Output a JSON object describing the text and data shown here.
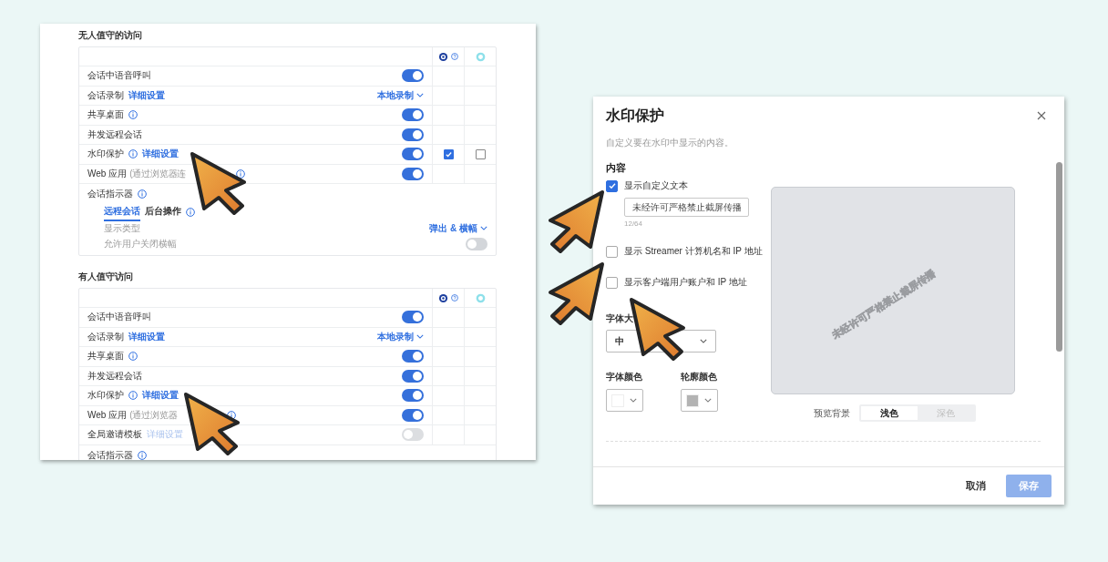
{
  "sections": [
    {
      "title": "无人值守的访问",
      "rows": [
        {
          "label": "会话中语音呼叫",
          "disabled": false,
          "control": {
            "kind": "toggle",
            "on": true
          }
        },
        {
          "label": "会话录制",
          "link": "详细设置",
          "disabled": false,
          "control": {
            "kind": "dropdown",
            "value": "本地录制"
          }
        },
        {
          "label": "共享桌面",
          "info": true,
          "disabled": false,
          "control": {
            "kind": "toggle",
            "on": true
          }
        },
        {
          "label": "并发远程会话",
          "disabled": false,
          "control": {
            "kind": "toggle",
            "on": true
          }
        },
        {
          "label": "水印保护",
          "info": true,
          "link": "详细设置",
          "disabled": false,
          "control": {
            "kind": "toggle",
            "on": true
          },
          "checks": [
            {
              "checked": true
            },
            {
              "checked": false
            }
          ]
        },
        {
          "label": "Web 应用",
          "note": "(通过浏览器连",
          "info": true,
          "disabled": false,
          "control": {
            "kind": "toggle",
            "on": true
          }
        }
      ],
      "indicator": {
        "label": "会话指示器",
        "info": true,
        "tabs": [
          {
            "label": "远程会话",
            "selected": true
          },
          {
            "label": "后台操作",
            "selected": false,
            "info": true
          }
        ],
        "settings": [
          {
            "label": "显示类型",
            "control": {
              "kind": "dropdown",
              "value": "弹出 & 横幅"
            }
          },
          {
            "label": "允许用户关闭横幅",
            "control": {
              "kind": "toggle",
              "on": false
            }
          }
        ]
      }
    },
    {
      "title": "有人值守访问",
      "rows": [
        {
          "label": "会话中语音呼叫",
          "disabled": false,
          "control": {
            "kind": "toggle",
            "on": true
          }
        },
        {
          "label": "会话录制",
          "link": "详细设置",
          "disabled": false,
          "control": {
            "kind": "dropdown",
            "value": "本地录制"
          }
        },
        {
          "label": "共享桌面",
          "info": true,
          "disabled": false,
          "control": {
            "kind": "toggle",
            "on": true
          }
        },
        {
          "label": "并发远程会话",
          "disabled": false,
          "control": {
            "kind": "toggle",
            "on": true
          }
        },
        {
          "label": "水印保护",
          "info": true,
          "link": "详细设置",
          "disabled": false,
          "control": {
            "kind": "toggle",
            "on": true
          }
        },
        {
          "label": "Web 应用",
          "note": "(通过浏览器",
          "info": true,
          "disabled": false,
          "control": {
            "kind": "toggle",
            "on": true
          }
        },
        {
          "label": "全局邀请模板",
          "link": "详细设置",
          "disabled": true,
          "control": {
            "kind": "toggle",
            "on": false
          }
        }
      ],
      "indicator": {
        "label": "会话指示器",
        "info": true
      }
    }
  ],
  "dialog": {
    "title": "水印保护",
    "subtitle": "自定义要在水印中显示的内容。",
    "section": "内容",
    "options": [
      {
        "label": "显示自定义文本",
        "checked": true,
        "text": {
          "value": "未经许可严格禁止截屏传播",
          "counter": "12/64"
        }
      },
      {
        "label": "显示 Streamer 计算机名和 IP 地址",
        "checked": false
      },
      {
        "label": "显示客户端用户账户和 IP 地址",
        "checked": false
      }
    ],
    "font_size": {
      "label": "字体大",
      "value": "中"
    },
    "colors": [
      {
        "label": "字体颜色",
        "color": "#ffffff"
      },
      {
        "label": "轮廓颜色",
        "color": "#b3b3b3"
      }
    ],
    "preview": {
      "watermark": "未经许可严格禁止截屏传播",
      "label": "预览背景",
      "modes": [
        {
          "label": "浅色",
          "selected": true
        },
        {
          "label": "深色",
          "selected": false
        }
      ]
    },
    "buttons": [
      {
        "label": "取消",
        "kind": "text",
        "disabled": false
      },
      {
        "label": "保存",
        "kind": "primary",
        "disabled": true
      }
    ]
  }
}
